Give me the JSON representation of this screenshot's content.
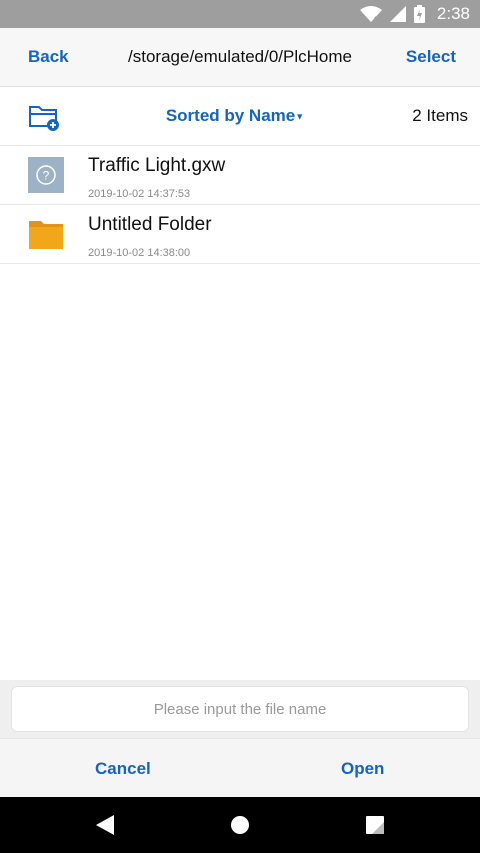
{
  "status_bar": {
    "time": "2:38"
  },
  "toolbar": {
    "back_label": "Back",
    "path": "/storage/emulated/0/PlcHome",
    "select_label": "Select"
  },
  "sortbar": {
    "sort_label": "Sorted by Name",
    "item_count": "2 Items"
  },
  "files": [
    {
      "name": "Traffic Light.gxw",
      "date": "2019-10-02 14:37:53",
      "icon": "unknown-file-icon"
    },
    {
      "name": "Untitled Folder",
      "date": "2019-10-02 14:38:00",
      "icon": "folder-icon"
    }
  ],
  "filename_input": {
    "placeholder": "Please input the file name",
    "value": ""
  },
  "actions": {
    "cancel_label": "Cancel",
    "open_label": "Open"
  },
  "colors": {
    "accent": "#1565c0",
    "status_bar": "#9e9e9e",
    "folder": "#f2a71b",
    "unknown_file": "#9eb2c7"
  }
}
